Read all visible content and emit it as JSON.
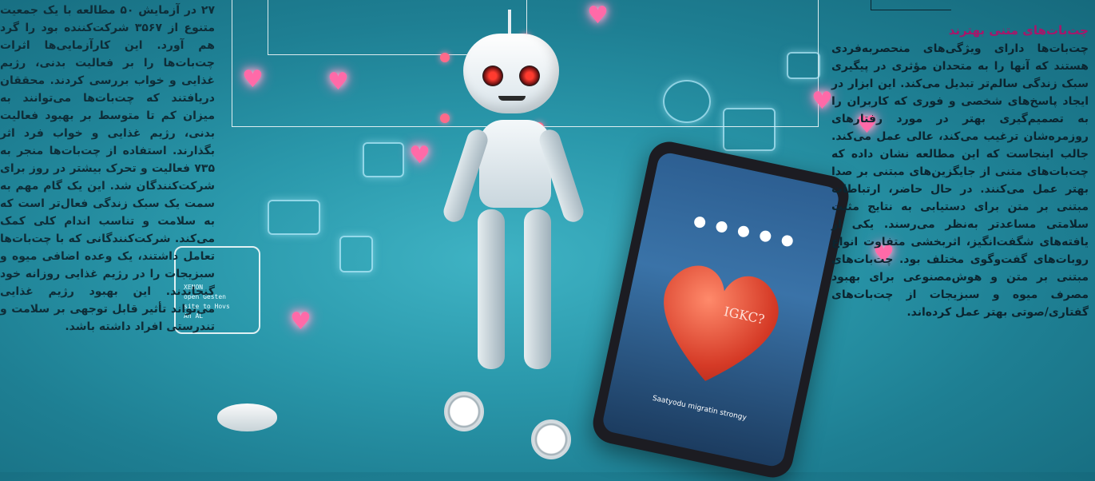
{
  "left_column": {
    "paragraph": "۲۷ در آزمایش ۵۰ مطالعه با یک جمعیت متنوع از ۳۵۶۷ شرکت‌کننده بود را گرد هم آورد. این کارآزمایی‌ها اثرات چت‌بات‌ها را بر فعالیت بدنی، رژیم غذایی و خواب بررسی کردند. محققان دریافتند که چت‌بات‌ها می‌توانند به میزان کم تا متوسط بر بهبود فعالیت بدنی، رژیم غذایی و خواب فرد اثر بگذارند. استفاده از چت‌بات‌ها منجر به ۷۳۵ فعالیت و تحرک بیشتر در روز برای شرکت‌کنندگان شد. این یک گام مهم به سمت یک سبک زندگی فعال‌تر است که به سلامت و تناسب اندام کلی کمک می‌کند. شرکت‌کنندگانی که با چت‌بات‌ها تعامل داشتند، یک وعده اضافی میوه و سبزیجات را در رژیم غذایی روزانه خود گنجاندند. این بهبود رژیم غذایی می‌تواند تأثیر قابل توجهی بر سلامت و تندرستی افراد داشته باشد."
  },
  "right_column": {
    "heading": "چت‌بات‌های متنی بهترند",
    "paragraph": "چت‌بات‌ها دارای ویژگی‌های منحصربه‌فردی هستند که آنها را به متحدان مؤثری در پیگیری سبک زندگی سالم‌تر تبدیل می‌کند. این ابزار در ایجاد پاسخ‌های شخصی و فوری که کاربران را به تصمیم‌گیری بهتر در مورد رفتارهای روزمره‌شان ترغیب می‌کند، عالی عمل می‌کند. جالب اینجاست که این مطالعه نشان داده که چت‌بات‌های متنی از جایگزین‌های مبتنی بر صدا بهتر عمل می‌کنند. در حال حاضر، ارتباطات مبتنی بر متن برای دستیابی به نتایج مثبت سلامتی مساعدتر به‌نظر می‌رسند. یکی از یافته‌های شگفت‌انگیز، اثربخشی متفاوت انواع روبات‌های گفت‌وگوی مختلف بود. چت‌بات‌های مبتنی بر متن و هوش‌مصنوعی برای بهبود مصرف میوه و سبزیجات از چت‌بات‌های گفتاری/صوتی بهتر عمل کرده‌اند."
  },
  "illustration": {
    "folder_text": "XENON\nopen Gesten\nsite to Hovs\nAn AL",
    "heart_label": "IGKC?",
    "phone_caption": "Saatyodu migratin strongy",
    "heading_color": "#a6176a"
  }
}
